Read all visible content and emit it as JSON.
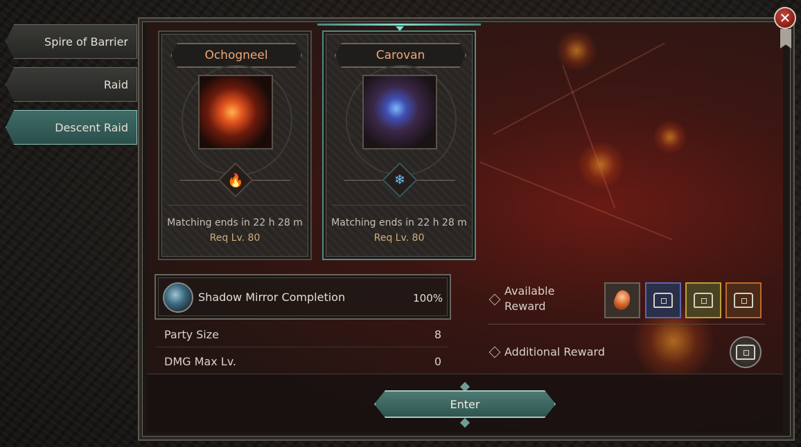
{
  "tabs": [
    {
      "label": "Spire of Barrier",
      "active": false
    },
    {
      "label": "Raid",
      "active": false
    },
    {
      "label": "Descent Raid",
      "active": true
    }
  ],
  "bosses": [
    {
      "name": "Ochogneel",
      "element": "fire",
      "element_icon": "fire-icon",
      "matching": "Matching ends in 22 h 28 m",
      "req": "Req Lv. 80",
      "selected": false
    },
    {
      "name": "Carovan",
      "element": "ice",
      "element_icon": "snowflake-icon",
      "matching": "Matching ends in 22 h 28 m",
      "req": "Req Lv. 80",
      "selected": true
    }
  ],
  "mirror": {
    "label": "Shadow Mirror Completion",
    "value": "100%"
  },
  "stats": [
    {
      "label": "Party Size",
      "value": "8"
    },
    {
      "label": "DMG Max Lv.",
      "value": "0"
    }
  ],
  "rewards": {
    "available_label_1": "Available",
    "available_label_2": "Reward",
    "additional_label": "Additional Reward",
    "items": [
      {
        "icon": "ore-icon",
        "border_color": "#6b655c",
        "bg": "#3a302a"
      },
      {
        "icon": "chest-icon",
        "border_color": "#5a67b3",
        "bg": "#2a2f4a"
      },
      {
        "icon": "chest-icon",
        "border_color": "#b9a23a",
        "bg": "#4a4220"
      },
      {
        "icon": "chest-icon",
        "border_color": "#c26a2a",
        "bg": "#4a2a18"
      }
    ]
  },
  "enter_label": "Enter",
  "close_label": "✕"
}
